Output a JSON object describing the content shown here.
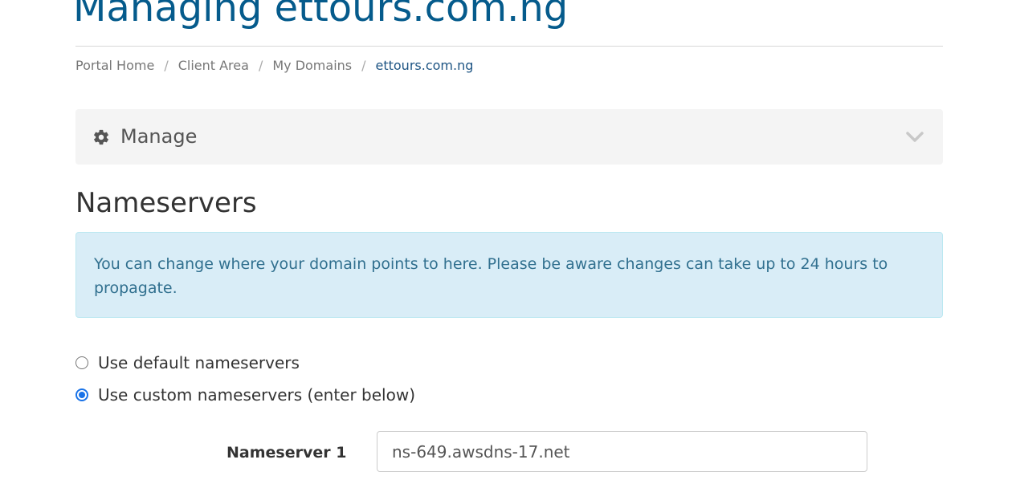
{
  "header": {
    "title": "Managing ettours.com.ng"
  },
  "breadcrumb": {
    "items": [
      "Portal Home",
      "Client Area",
      "My Domains",
      "ettours.com.ng"
    ],
    "separator": "/"
  },
  "manage": {
    "label": "Manage",
    "icon": "gear-icon",
    "toggle_icon": "chevron-down-icon"
  },
  "nameservers": {
    "heading": "Nameservers",
    "info": "You can change where your domain points to here. Please be aware changes can take up to 24 hours to propagate.",
    "options": [
      {
        "label": "Use default nameservers",
        "checked": false
      },
      {
        "label": "Use custom nameservers (enter below)",
        "checked": true
      }
    ],
    "fields": [
      {
        "label": "Nameserver 1",
        "value": "ns-649.awsdns-17.net"
      }
    ]
  },
  "colors": {
    "title": "#055b8c",
    "info_bg": "#d9edf7",
    "info_text": "#31708f",
    "radio_accent": "#1a73e8"
  }
}
